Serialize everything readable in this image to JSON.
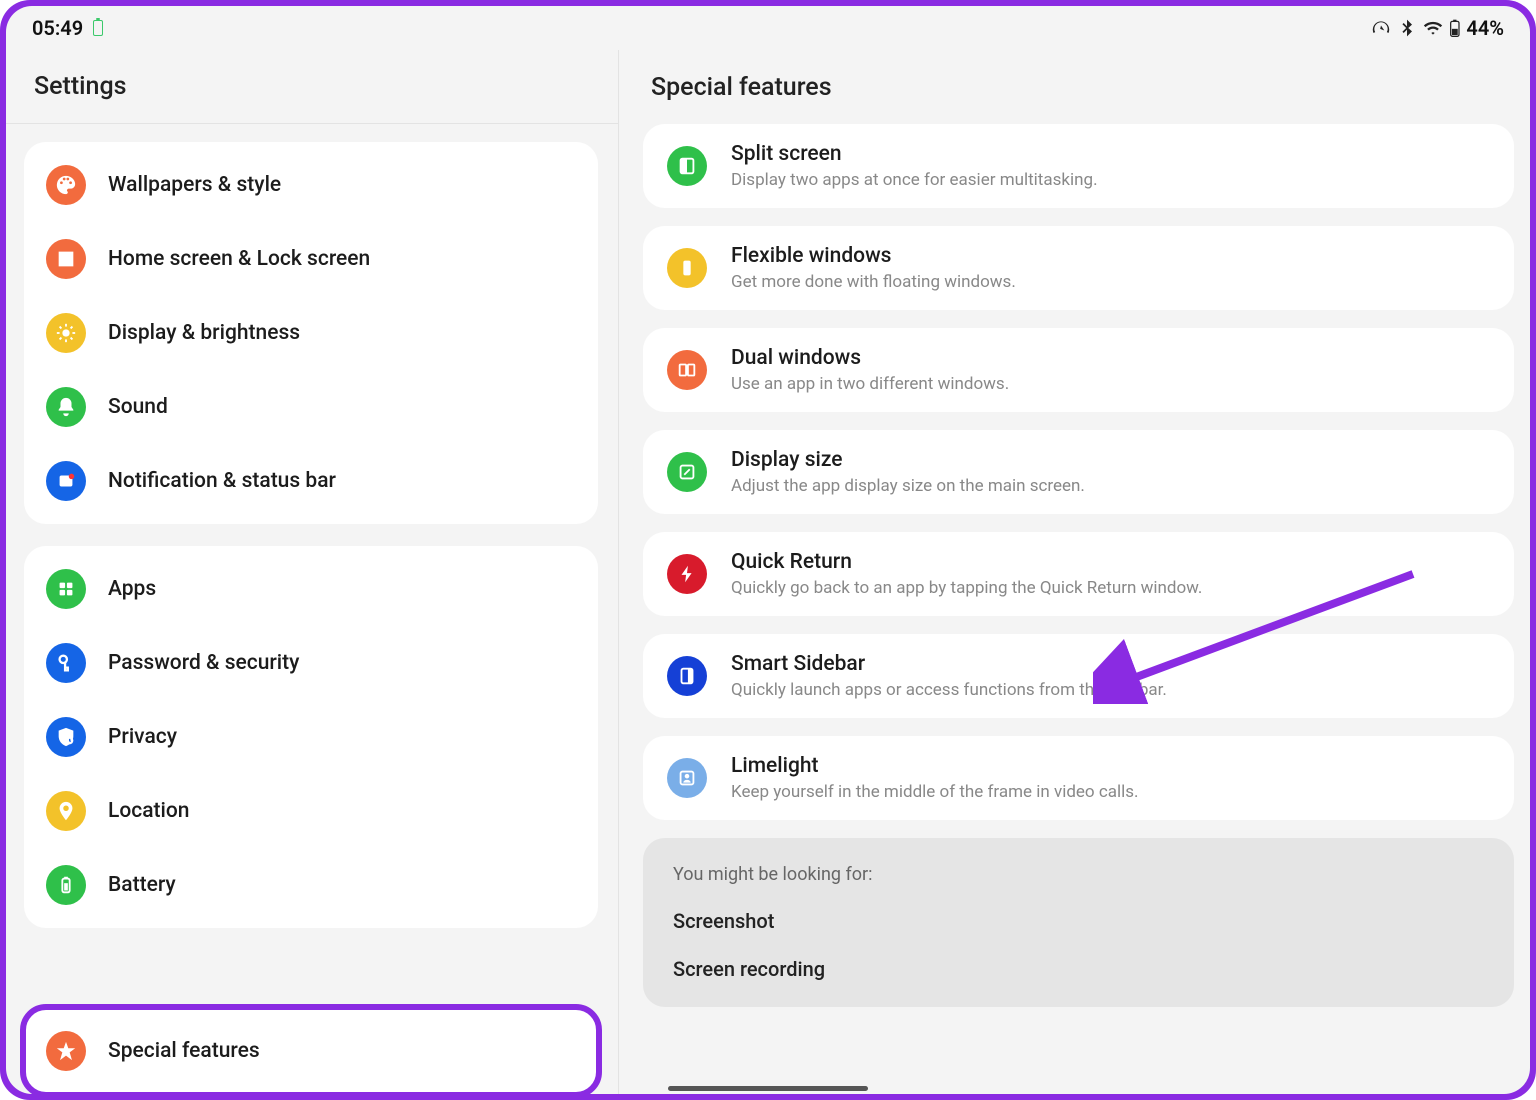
{
  "statusbar": {
    "time": "05:49",
    "battery_pct": "44%"
  },
  "leftpane": {
    "title": "Settings",
    "groups": [
      {
        "items": [
          {
            "name": "wallpapers-style",
            "label": "Wallpapers & style",
            "icon": "palette",
            "color": "#f26b3e"
          },
          {
            "name": "home-lock-screen",
            "label": "Home screen & Lock screen",
            "icon": "image",
            "color": "#f26b3e"
          },
          {
            "name": "display-brightness",
            "label": "Display & brightness",
            "icon": "sun",
            "color": "#f3c22a"
          },
          {
            "name": "sound",
            "label": "Sound",
            "icon": "bell",
            "color": "#2fc04a"
          },
          {
            "name": "notification-statusbar",
            "label": "Notification & status bar",
            "icon": "notif",
            "color": "#1565e6"
          }
        ]
      },
      {
        "items": [
          {
            "name": "apps",
            "label": "Apps",
            "icon": "grid",
            "color": "#2fc04a"
          },
          {
            "name": "password-security",
            "label": "Password & security",
            "icon": "key",
            "color": "#1565e6"
          },
          {
            "name": "privacy",
            "label": "Privacy",
            "icon": "shield",
            "color": "#1565e6"
          },
          {
            "name": "location",
            "label": "Location",
            "icon": "pin",
            "color": "#f3c22a"
          },
          {
            "name": "battery",
            "label": "Battery",
            "icon": "battery",
            "color": "#2fc04a"
          }
        ]
      }
    ],
    "selected": {
      "name": "special-features",
      "label": "Special features",
      "icon": "star",
      "color": "#f26b3e"
    }
  },
  "rightpane": {
    "title": "Special features",
    "features": [
      {
        "name": "split-screen",
        "title": "Split screen",
        "desc": "Display two apps at once for easier multitasking.",
        "icon": "square-left",
        "color": "#2fc04a"
      },
      {
        "name": "flexible-windows",
        "title": "Flexible windows",
        "desc": "Get more done with floating windows.",
        "icon": "phone",
        "color": "#f3c22a"
      },
      {
        "name": "dual-windows",
        "title": "Dual windows",
        "desc": "Use an app in two different windows.",
        "icon": "dual",
        "color": "#f26b3e"
      },
      {
        "name": "display-size",
        "title": "Display size",
        "desc": "Adjust the app display size on the main screen.",
        "icon": "expand",
        "color": "#2fc04a"
      },
      {
        "name": "quick-return",
        "title": "Quick Return",
        "desc": "Quickly go back to an app by tapping the Quick Return window.",
        "icon": "bolt",
        "color": "#d81b2c"
      },
      {
        "name": "smart-sidebar",
        "title": "Smart Sidebar",
        "desc": "Quickly launch apps or access functions from the sidebar.",
        "icon": "sidebar",
        "color": "#1540d6"
      },
      {
        "name": "limelight",
        "title": "Limelight",
        "desc": "Keep yourself in the middle of the frame in video calls.",
        "icon": "person",
        "color": "#7aaee8"
      }
    ],
    "suggestions": {
      "hint": "You might be looking for:",
      "items": [
        "Screenshot",
        "Screen recording"
      ]
    }
  }
}
